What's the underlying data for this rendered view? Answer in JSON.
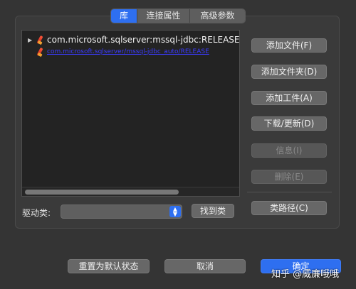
{
  "tabs": [
    {
      "label": "库",
      "active": true
    },
    {
      "label": "连接属性",
      "active": false
    },
    {
      "label": "高级参数",
      "active": false
    }
  ],
  "libraries": [
    {
      "name": "com.microsoft.sqlserver:mssql-jdbc:RELEASE",
      "expanded": false
    },
    {
      "name": "com.microsoft.sqlserver/mssql-jdbc_auto/RELEASE",
      "link": true
    }
  ],
  "side_buttons": {
    "add_file": "添加文件(F)",
    "add_folder": "添加文件夹(D)",
    "add_artifact": "添加工件(A)",
    "download_update": "下载/更新(D)",
    "info": "信息(I)",
    "delete": "删除(E)",
    "class_path": "类路径(C)"
  },
  "driver": {
    "label": "驱动类:",
    "value": "",
    "find_button": "找到类"
  },
  "footer": {
    "reset": "重置为默认状态",
    "cancel": "取消",
    "ok": "确定"
  },
  "watermark": "知乎 @威廉哦哦",
  "colors": {
    "accent": "#2e6ff0",
    "background": "#343434",
    "link": "#3b3bff"
  }
}
